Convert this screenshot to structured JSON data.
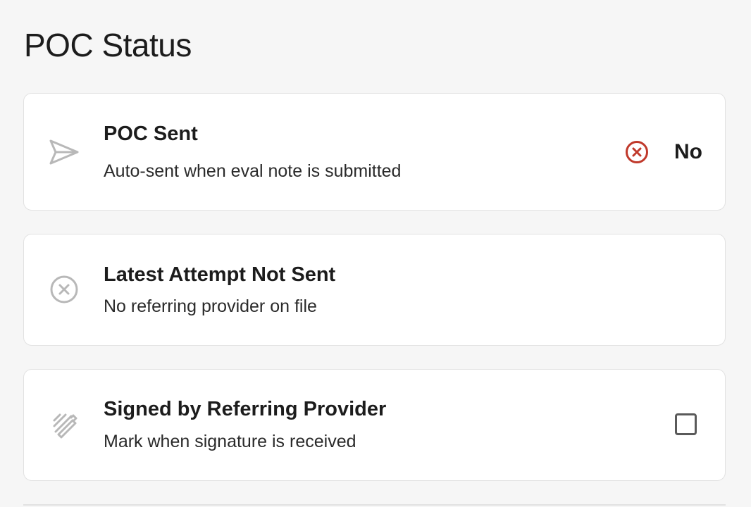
{
  "page": {
    "title": "POC Status"
  },
  "cards": [
    {
      "icon": "send-icon",
      "title": "POC Sent",
      "subtitle": "Auto-sent when eval note is submitted",
      "status": {
        "icon": "x-circle-icon",
        "value": "No",
        "color": "#c0392b"
      }
    },
    {
      "icon": "x-circle-icon",
      "title": "Latest Attempt Not Sent",
      "subtitle": "No referring provider on file"
    },
    {
      "icon": "signature-icon",
      "title": "Signed by Referring Provider",
      "subtitle": "Mark when signature is received",
      "checkbox": {
        "checked": false
      }
    }
  ],
  "colors": {
    "background": "#f6f6f6",
    "card": "#ffffff",
    "border": "#e2e2e2",
    "icon_muted": "#b8b8b8",
    "status_error": "#c0392b"
  }
}
